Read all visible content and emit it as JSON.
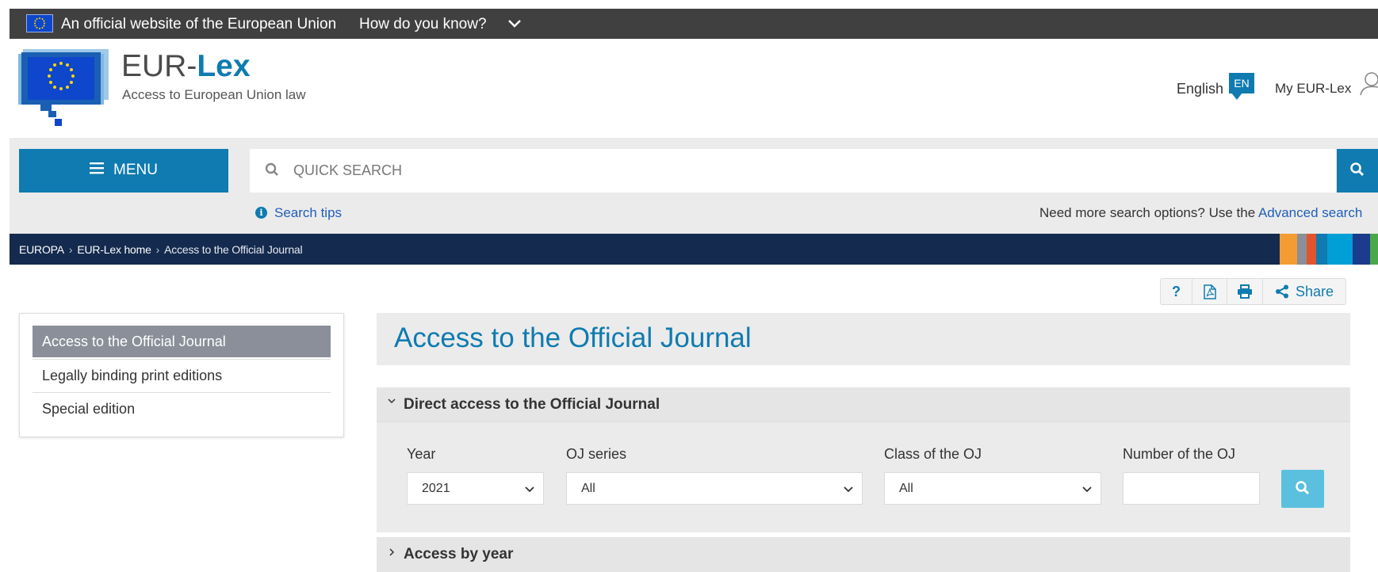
{
  "banner": {
    "text": "An official website of the European Union",
    "how_know": "How do you know?"
  },
  "header": {
    "title_prefix": "EUR-",
    "title_suffix": "Lex",
    "subtitle": "Access to European Union law",
    "language": "English",
    "language_code": "EN",
    "my_account": "My EUR-Lex"
  },
  "search": {
    "menu_label": "MENU",
    "placeholder": "QUICK SEARCH",
    "value": "",
    "tips_label": "Search tips",
    "advanced_prefix": "Need more search options? Use the ",
    "advanced_link": "Advanced search"
  },
  "breadcrumb": {
    "items": [
      "EUROPA",
      "EUR-Lex home",
      "Access to the Official Journal"
    ],
    "colors": [
      "#f39c34",
      "#8a8f99",
      "#e2542b",
      "#0f7bb0",
      "#00a0d7",
      "#1b3c8c",
      "#4aa84a"
    ]
  },
  "tools": {
    "help": "?",
    "share": "Share"
  },
  "left_nav": {
    "items": [
      {
        "label": "Access to the Official Journal",
        "active": true
      },
      {
        "label": "Legally binding print editions",
        "active": false
      },
      {
        "label": "Special edition",
        "active": false
      }
    ]
  },
  "main": {
    "title": "Access to the Official Journal",
    "direct_access": {
      "title": "Direct access to the Official Journal",
      "year_label": "Year",
      "year_value": "2021",
      "series_label": "OJ series",
      "series_value": "All",
      "class_label": "Class of the OJ",
      "class_value": "All",
      "number_label": "Number of the OJ",
      "number_value": ""
    },
    "access_by_year": {
      "title": "Access by year"
    }
  },
  "colors": {
    "brand": "#0f7bb0",
    "banner": "#404040",
    "breadcrumb": "#142a4e",
    "link": "#1f5fb8",
    "search_button": "#5bc0de",
    "nav_active": "#8a8f99"
  }
}
